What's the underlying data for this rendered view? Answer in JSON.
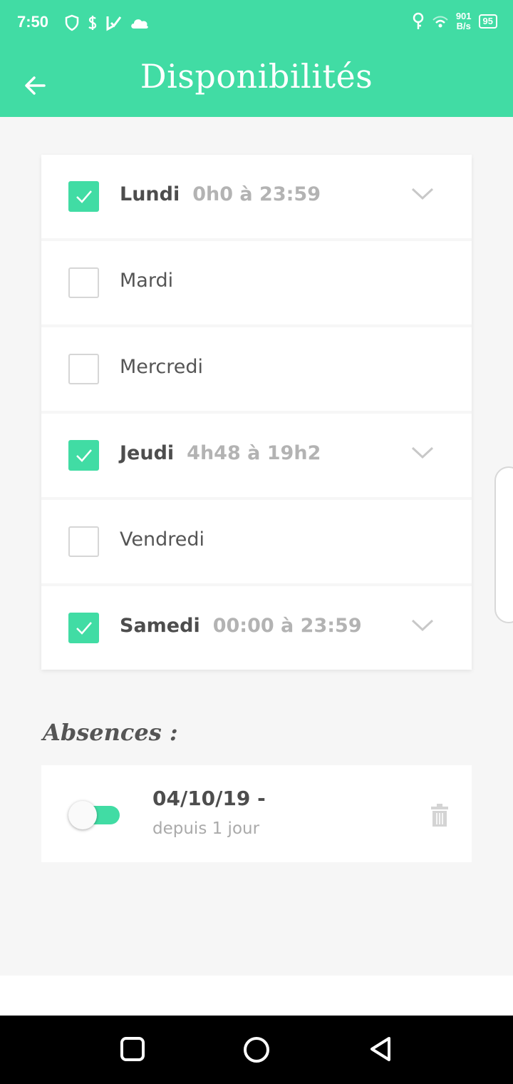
{
  "status_bar": {
    "time": "7:50",
    "net_speed_value": "901",
    "net_speed_unit": "B/s",
    "battery": "95"
  },
  "header": {
    "title": "Disponibilités"
  },
  "days": [
    {
      "name": "Lundi",
      "checked": true,
      "time": "0h0 à 23:59"
    },
    {
      "name": "Mardi",
      "checked": false,
      "time": ""
    },
    {
      "name": "Mercredi",
      "checked": false,
      "time": ""
    },
    {
      "name": "Jeudi",
      "checked": true,
      "time": "4h48 à 19h2"
    },
    {
      "name": "Vendredi",
      "checked": false,
      "time": ""
    },
    {
      "name": "Samedi",
      "checked": true,
      "time": "00:00 à 23:59"
    }
  ],
  "absences": {
    "title": "Absences :",
    "items": [
      {
        "date": "04/10/19 -",
        "duration": "depuis 1 jour",
        "enabled": true
      }
    ]
  },
  "colors": {
    "accent": "#41dca4"
  }
}
